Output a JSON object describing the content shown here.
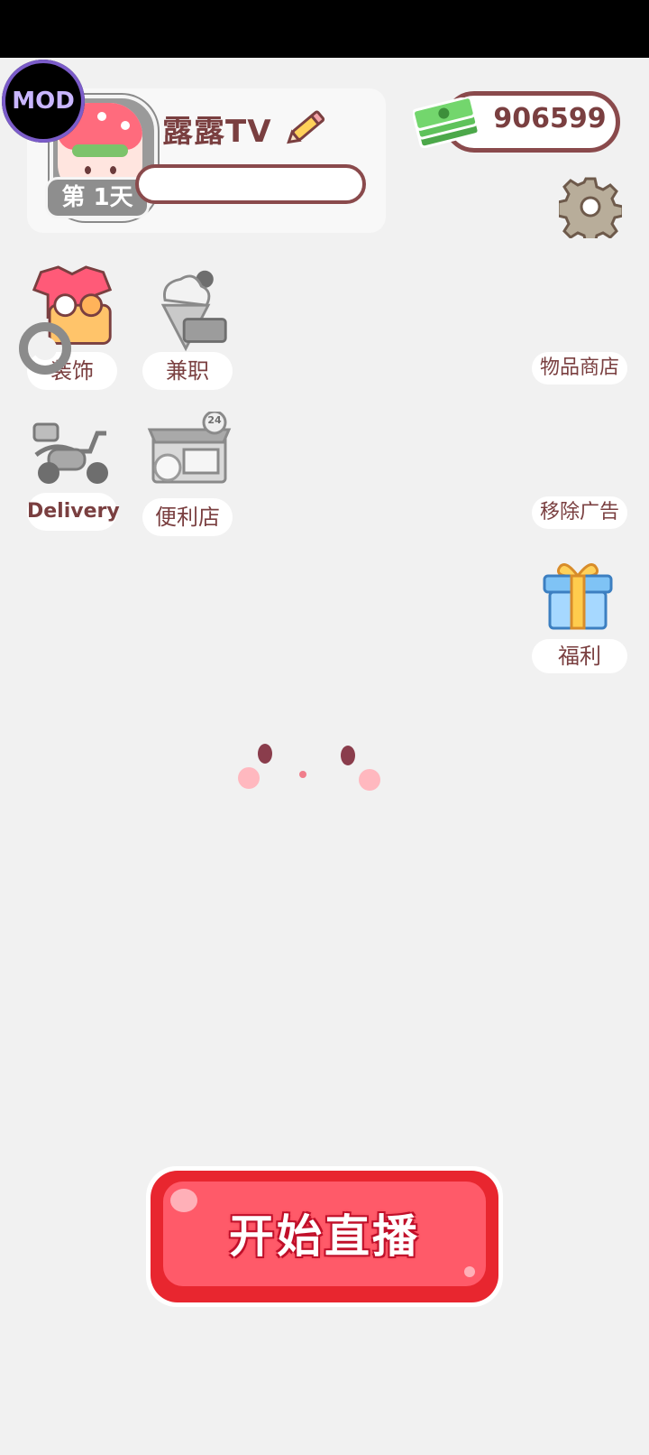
{
  "mod_badge": "MOD",
  "profile": {
    "name": "露露TV",
    "day_label": "第 1天"
  },
  "currency": {
    "amount": "906599"
  },
  "features": {
    "decoration": "装饰",
    "part_time": "兼职",
    "delivery": "Delivery",
    "convenience_store": "便利店",
    "store_sign_number": "24"
  },
  "side": {
    "item_shop": "物品商店",
    "remove_ads": "移除广告",
    "welfare": "福利"
  },
  "start_button": "开始直播",
  "colors": {
    "accent_red": "#e8262f",
    "text_brown": "#7a3f40",
    "background": "#f1f1f1"
  }
}
